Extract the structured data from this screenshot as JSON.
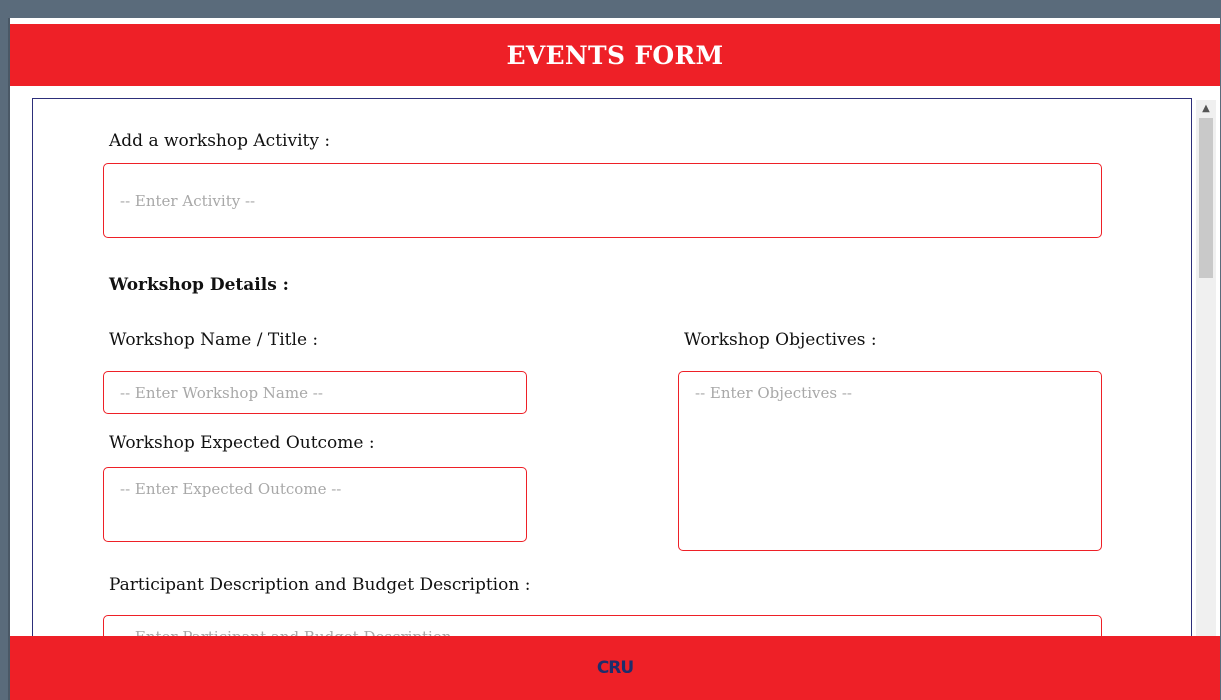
{
  "header": {
    "title": "EVENTS FORM"
  },
  "form": {
    "activity": {
      "label": "Add a workshop Activity :",
      "placeholder": "-- Enter Activity --"
    },
    "details_heading": "Workshop Details :",
    "workshop_name": {
      "label": "Workshop Name / Title :",
      "placeholder": "-- Enter Workshop Name --"
    },
    "objectives": {
      "label": "Workshop Objectives :",
      "placeholder": "-- Enter Objectives --"
    },
    "expected_outcome": {
      "label": "Workshop Expected Outcome :",
      "placeholder": "-- Enter Expected Outcome --"
    },
    "participant_budget": {
      "label": "Participant Description and Budget Description :",
      "placeholder": "-- Enter Participant and Budget Description --"
    }
  },
  "footer": {
    "logo_text": "CRU"
  },
  "colors": {
    "brand_red": "#ee2027",
    "border_navy": "#2d2f7a"
  }
}
